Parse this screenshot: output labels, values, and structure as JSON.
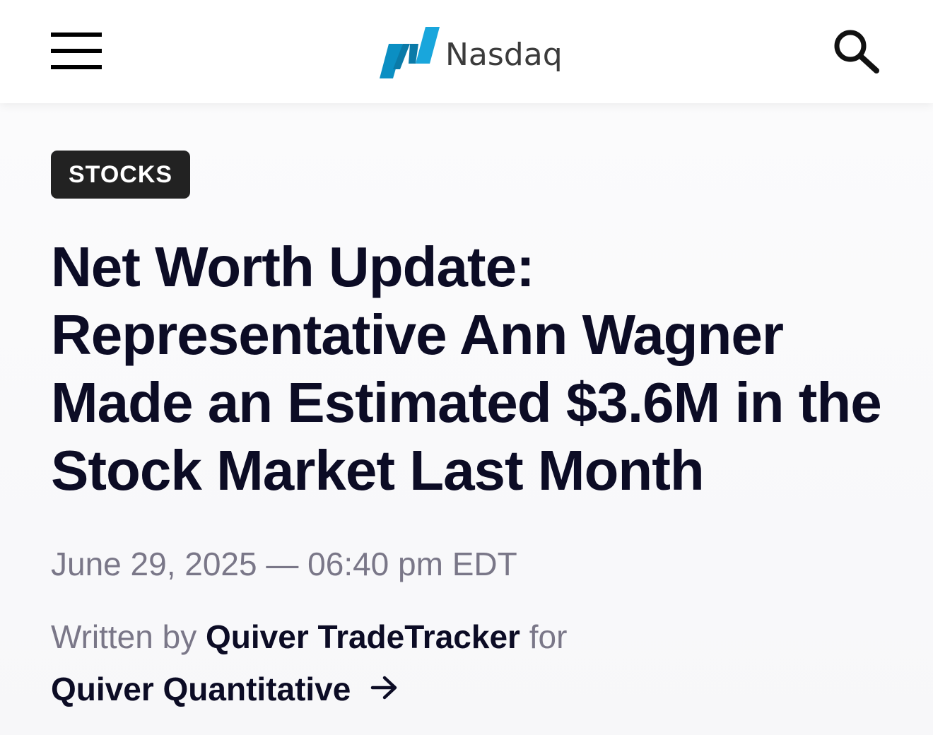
{
  "header": {
    "menu_icon": "hamburger-menu-icon",
    "logo": {
      "text": "Nasdaq",
      "mark_color": "#0996C7"
    },
    "search_icon": "search-icon"
  },
  "article": {
    "category": "STOCKS",
    "headline": "Net Worth Update: Representative Ann Wagner Made an Estimated $3.6M in the Stock Market Last Month",
    "dateline": "June 29, 2025 — 06:40 pm EDT",
    "byline": {
      "prefix": "Written by",
      "author": "Quiver TradeTracker",
      "connector": "for",
      "source": "Quiver Quantitative",
      "source_icon": "arrow-right-icon"
    }
  },
  "colors": {
    "headline": "#0C0C25",
    "muted_text": "#7A7788",
    "tag_background": "#222222"
  }
}
